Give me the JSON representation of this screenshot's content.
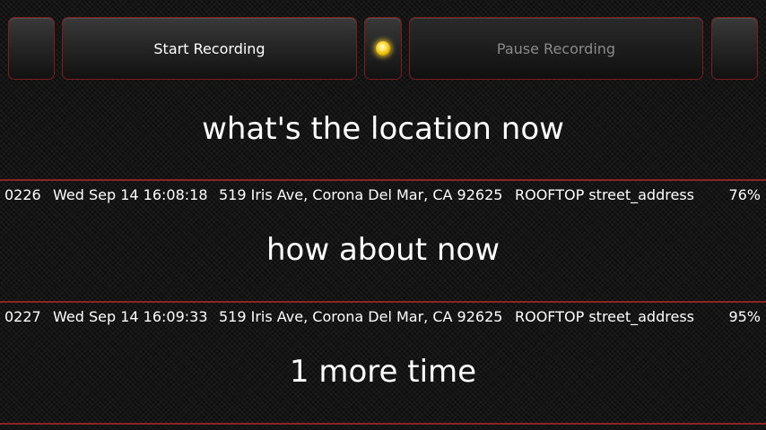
{
  "toolbar": {
    "start_label": "Start Recording",
    "pause_label": "Pause Recording",
    "recording_indicator": "yellow-led-icon",
    "led_color": "#ffd23a",
    "border_color": "#7a1e1e"
  },
  "transcript": [
    {
      "prompt": "what's the location now",
      "result": {
        "seq": "0226",
        "timestamp": "Wed Sep 14 16:08:18",
        "address": "519 Iris Ave,  Corona Del Mar,  CA 92625",
        "type": "ROOFTOP street_address",
        "confidence": "76%"
      }
    },
    {
      "prompt": "how about now",
      "result": {
        "seq": "0227",
        "timestamp": "Wed Sep 14 16:09:33",
        "address": "519 Iris Ave,  Corona Del Mar,  CA 92625",
        "type": "ROOFTOP street_address",
        "confidence": "95%"
      }
    },
    {
      "prompt": "1 more time"
    }
  ],
  "separator_color": "#8c2424"
}
